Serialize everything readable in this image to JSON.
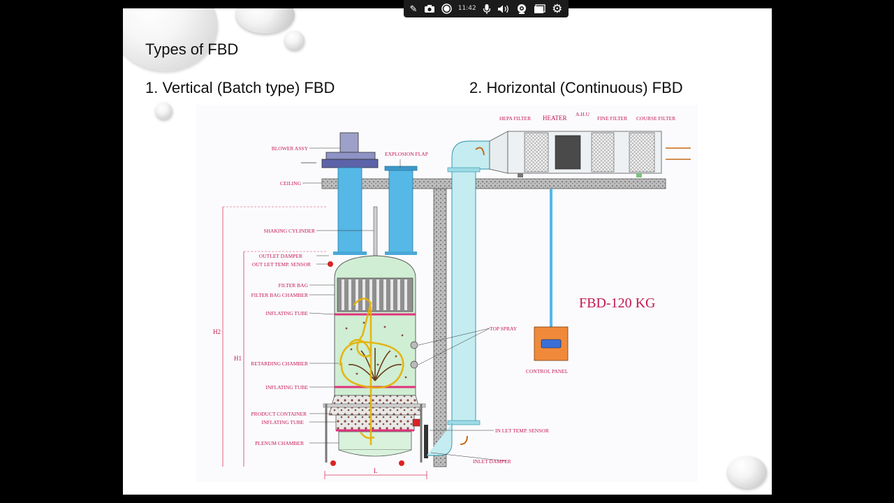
{
  "slide": {
    "title": "Types of FBD",
    "heading_left": "1. Vertical (Batch type) FBD",
    "heading_right": "2. Horizontal (Continuous) FBD"
  },
  "diagram": {
    "labels": {
      "blower": "BLOWER ASSY",
      "explosion": "EXPLOSION FLAP",
      "ceiling": "CEILING",
      "shaking": "SHAKING CYLINDER",
      "outlet_damper": "OUTLET DAMPER",
      "outlet_sensor": "OUT LET TEMP. SENSOR",
      "filter_bag": "FILTER BAG",
      "filter_chamber": "FILTER BAG CHAMBER",
      "inflating1": "INFLATING TUBE",
      "retarding": "RETARDING CHAMBER",
      "inflating2": "INFLATING TUBE",
      "product_container": "PRODUCT CONTAINER",
      "inflating3": "INFLATING TUBE",
      "plenum": "PLENUM CHAMBER",
      "h2": "H2",
      "h1": "H1",
      "l": "L",
      "hepa": "HEPA FILTER",
      "heater": "HEATER",
      "ahu": "A.H.U",
      "fine": "FINE FILTER",
      "course": "COURSE FILTER",
      "top_spray": "TOP SPRAY",
      "model": "FBD-120 KG",
      "control_panel": "CONTROL PANEL",
      "inlet_sensor": "IN LET TEMP. SENSOR",
      "inlet_damper": "INLET DAMPER"
    },
    "colors": {
      "label": "#c4174f",
      "duct_blue": "#55b8e6",
      "chamber_green": "#cfeed3",
      "annotation": "#e6b000",
      "ceiling_gray": "#8f8f8f"
    }
  },
  "toolbar": {
    "time": "11:42",
    "icons": [
      "pen-icon",
      "camera-icon",
      "record-icon",
      "mic-icon",
      "speaker-icon",
      "webcam-icon",
      "window-icon",
      "gear-icon"
    ]
  }
}
